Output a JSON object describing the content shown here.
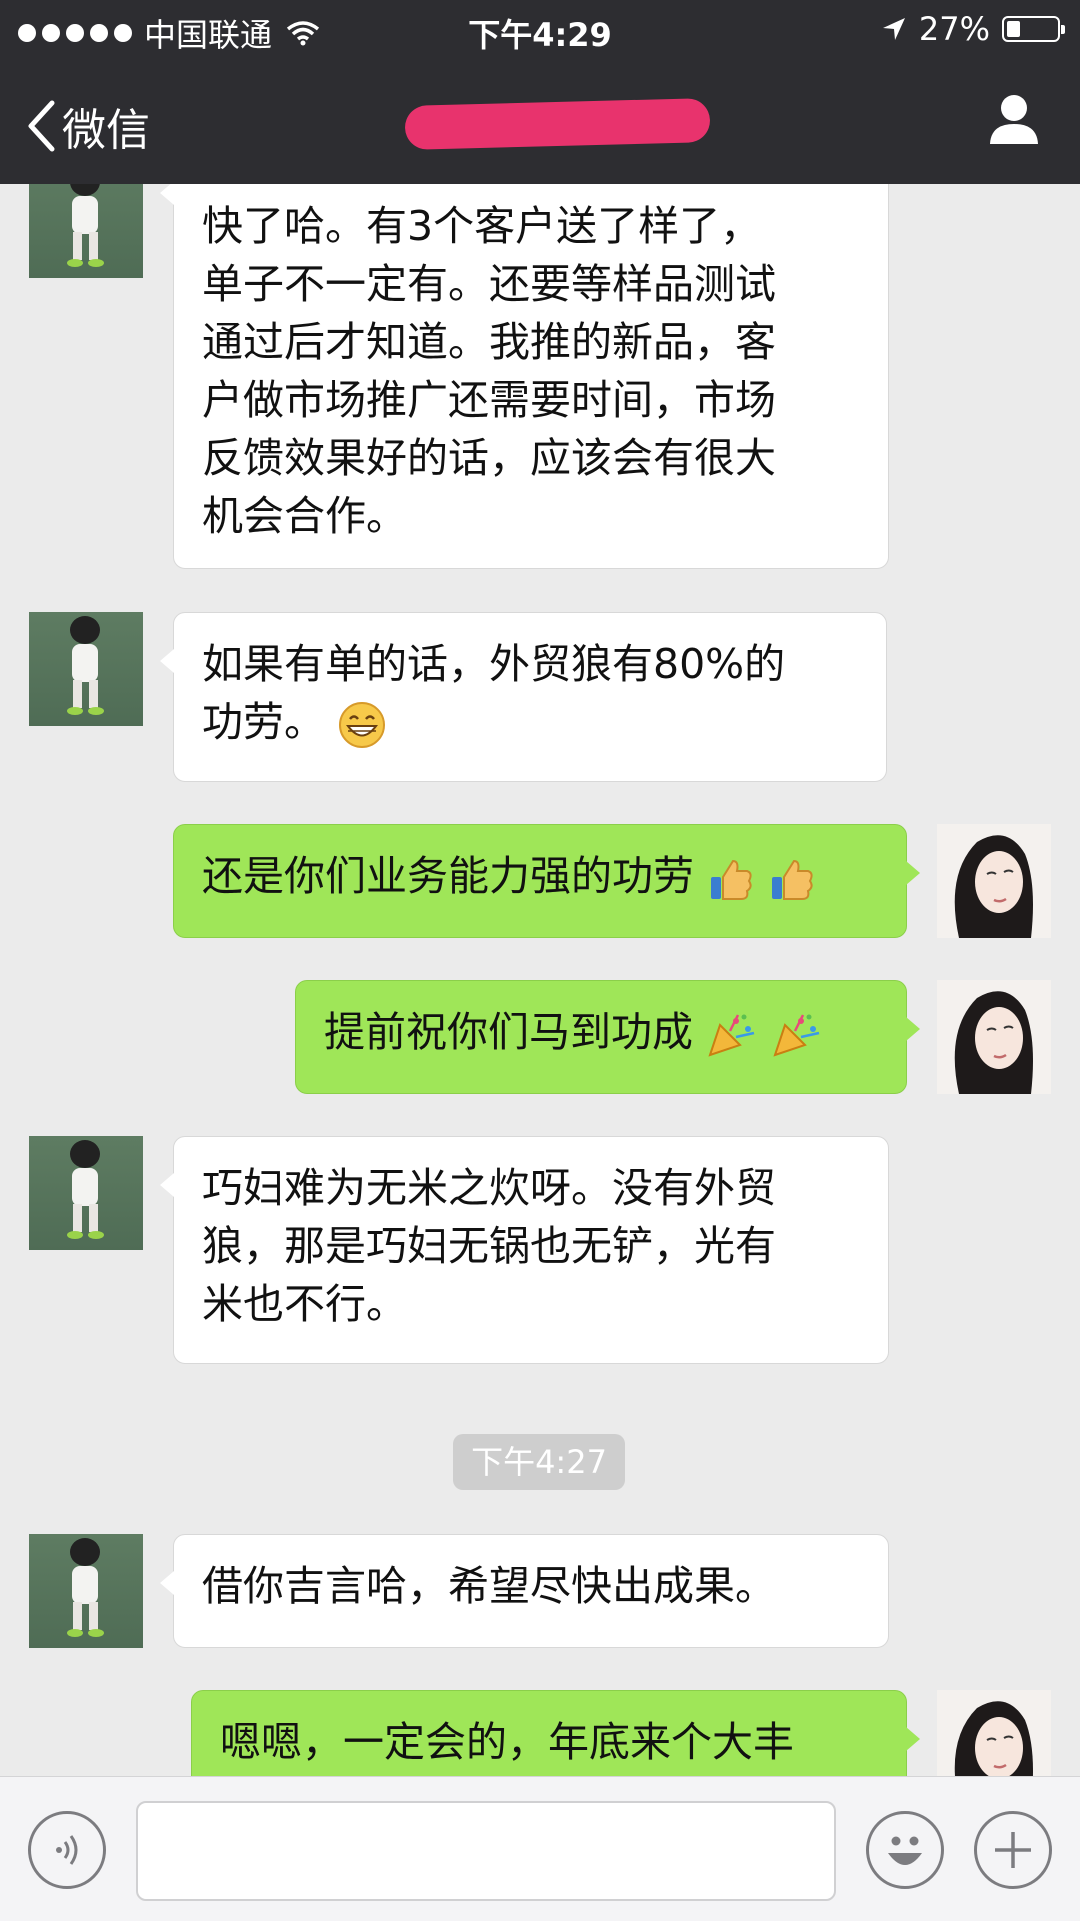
{
  "status_bar": {
    "carrier": "中国联通",
    "time": "下午4:29",
    "battery_text": "27%",
    "battery_level": 0.27
  },
  "nav": {
    "back_label": "微信",
    "title": ""
  },
  "messages": [
    {
      "side": "in",
      "lines": [
        "快了哈。有3个客户送了样了，",
        "单子不一定有。还要等样品测试",
        "通过后才知道。我推的新品，客",
        "户做市场推广还需要时间，市场",
        "反馈效果好的话，应该会有很大",
        "机会合作。"
      ]
    },
    {
      "side": "in",
      "lines": [
        "如果有单的话，外贸狼有80%的",
        "功劳。"
      ],
      "emoji": "grin-emoji"
    },
    {
      "side": "out",
      "lines": [
        "还是你们业务能力强的功劳"
      ],
      "emoji": "thumbs-up-emoji"
    },
    {
      "side": "out",
      "lines": [
        "提前祝你们马到功成"
      ],
      "emoji": "party-popper-emoji"
    },
    {
      "side": "in",
      "lines": [
        "巧妇难为无米之炊呀。没有外贸",
        "狼，那是巧妇无锅也无铲，光有",
        "米也不行。"
      ]
    },
    {
      "side": "in",
      "lines": [
        "借你吉言哈，希望尽快出成果。"
      ]
    },
    {
      "side": "out",
      "lines": [
        "嗯嗯，一定会的，年底来个大丰"
      ]
    }
  ],
  "time_separator": "下午4:27",
  "input_bar": {
    "placeholder": "",
    "icons": [
      "voice-icon",
      "emoji-icon",
      "plus-icon"
    ]
  },
  "colors": {
    "bar_bg": "#2d2d31",
    "chat_bg": "#ebebeb",
    "out_bubble": "#9fe658",
    "in_bubble": "#ffffff",
    "redaction": "#e8336d"
  }
}
